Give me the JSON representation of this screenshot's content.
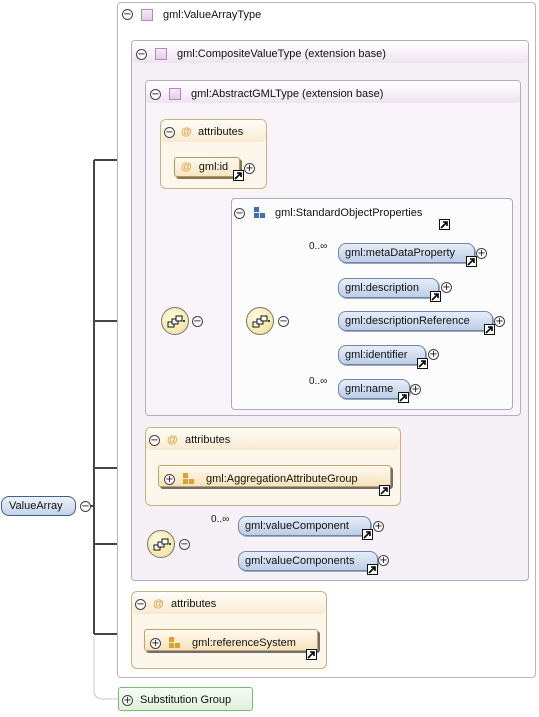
{
  "root": {
    "label": "ValueArray",
    "substitution_group": "Substitution Group"
  },
  "value_array_type": {
    "title": "gml:ValueArrayType"
  },
  "composite_value_type": {
    "title": "gml:CompositeValueType (extension base)"
  },
  "abstract_gml_type": {
    "title": "gml:AbstractGMLType (extension base)",
    "attributes_label": "attributes",
    "id_attribute": "gml:id"
  },
  "standard_object_properties": {
    "title": "gml:StandardObjectProperties",
    "elements": [
      {
        "label": "gml:metaDataProperty",
        "cardinality": "0..∞"
      },
      {
        "label": "gml:description",
        "cardinality": ""
      },
      {
        "label": "gml:descriptionReference",
        "cardinality": ""
      },
      {
        "label": "gml:identifier",
        "cardinality": ""
      },
      {
        "label": "gml:name",
        "cardinality": "0..∞"
      }
    ]
  },
  "composite_attributes": {
    "attributes_label": "attributes",
    "group": "gml:AggregationAttributeGroup"
  },
  "value_components": {
    "elements": [
      {
        "label": "gml:valueComponent",
        "cardinality": "0..∞"
      },
      {
        "label": "gml:valueComponents",
        "cardinality": ""
      }
    ]
  },
  "array_attributes": {
    "attributes_label": "attributes",
    "group": "gml:referenceSystem"
  },
  "icons": {
    "collapse": "minus-circle-icon",
    "expand": "plus-circle-icon",
    "link": "link-arrow-icon",
    "sequence": "sequence-compositor-icon",
    "attribute": "attribute-at-icon",
    "attribute_group": "attribute-group-icon",
    "complex_type": "complex-type-icon",
    "element_group": "element-group-icon"
  },
  "colors": {
    "element_fill": "#bccde6",
    "attribute_fill": "#f7e5c0",
    "type_fill": "#f6f1f7",
    "substitution_fill": "#dff1da",
    "connector": "#404040"
  }
}
